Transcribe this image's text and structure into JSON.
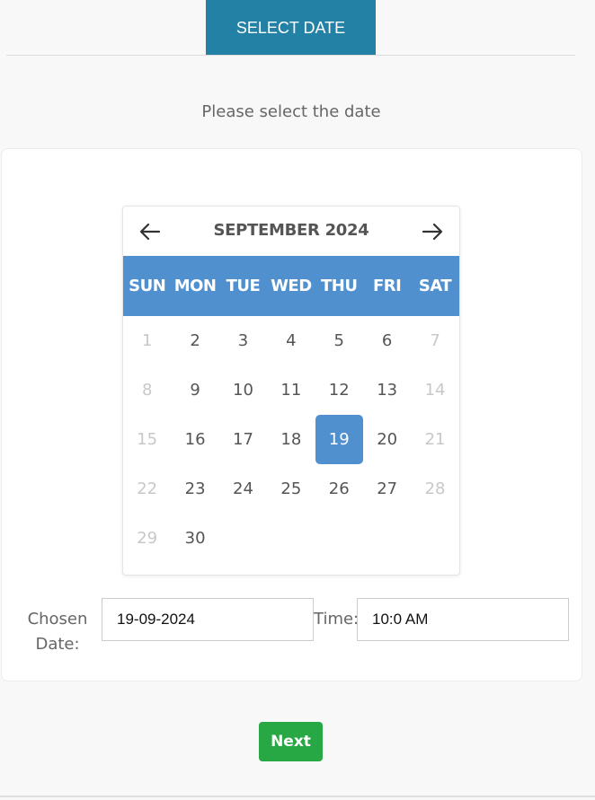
{
  "tab": {
    "label": "SELECT DATE"
  },
  "subtitle": "Please select the date",
  "calendar": {
    "month_label": "SEPTEMBER 2024",
    "weekdays": [
      "SUN",
      "MON",
      "TUE",
      "WED",
      "THU",
      "FRI",
      "SAT"
    ],
    "selected_day": "19",
    "weeks": [
      [
        {
          "d": "1",
          "muted": true
        },
        {
          "d": "2"
        },
        {
          "d": "3"
        },
        {
          "d": "4"
        },
        {
          "d": "5"
        },
        {
          "d": "6"
        },
        {
          "d": "7",
          "muted": true
        }
      ],
      [
        {
          "d": "8",
          "muted": true
        },
        {
          "d": "9"
        },
        {
          "d": "10"
        },
        {
          "d": "11"
        },
        {
          "d": "12"
        },
        {
          "d": "13"
        },
        {
          "d": "14",
          "muted": true
        }
      ],
      [
        {
          "d": "15",
          "muted": true
        },
        {
          "d": "16"
        },
        {
          "d": "17"
        },
        {
          "d": "18"
        },
        {
          "d": "19"
        },
        {
          "d": "20"
        },
        {
          "d": "21",
          "muted": true
        }
      ],
      [
        {
          "d": "22",
          "muted": true
        },
        {
          "d": "23"
        },
        {
          "d": "24"
        },
        {
          "d": "25"
        },
        {
          "d": "26"
        },
        {
          "d": "27"
        },
        {
          "d": "28",
          "muted": true
        }
      ],
      [
        {
          "d": "29",
          "muted": true
        },
        {
          "d": "30"
        },
        {
          "d": ""
        },
        {
          "d": ""
        },
        {
          "d": ""
        },
        {
          "d": ""
        },
        {
          "d": ""
        }
      ]
    ],
    "colors": {
      "header_bg": "#5190cf",
      "selected_bg": "#5190cf",
      "muted_text": "#c8c8c8"
    }
  },
  "form": {
    "chosen_date_label": "Chosen Date:",
    "chosen_date_value": "19-09-2024",
    "time_label": "Time:",
    "time_value": "10:0 AM"
  },
  "next_button": {
    "label": "Next",
    "color": "#28a745"
  },
  "icons": {
    "prev": "arrow-left-icon",
    "next": "arrow-right-icon"
  }
}
